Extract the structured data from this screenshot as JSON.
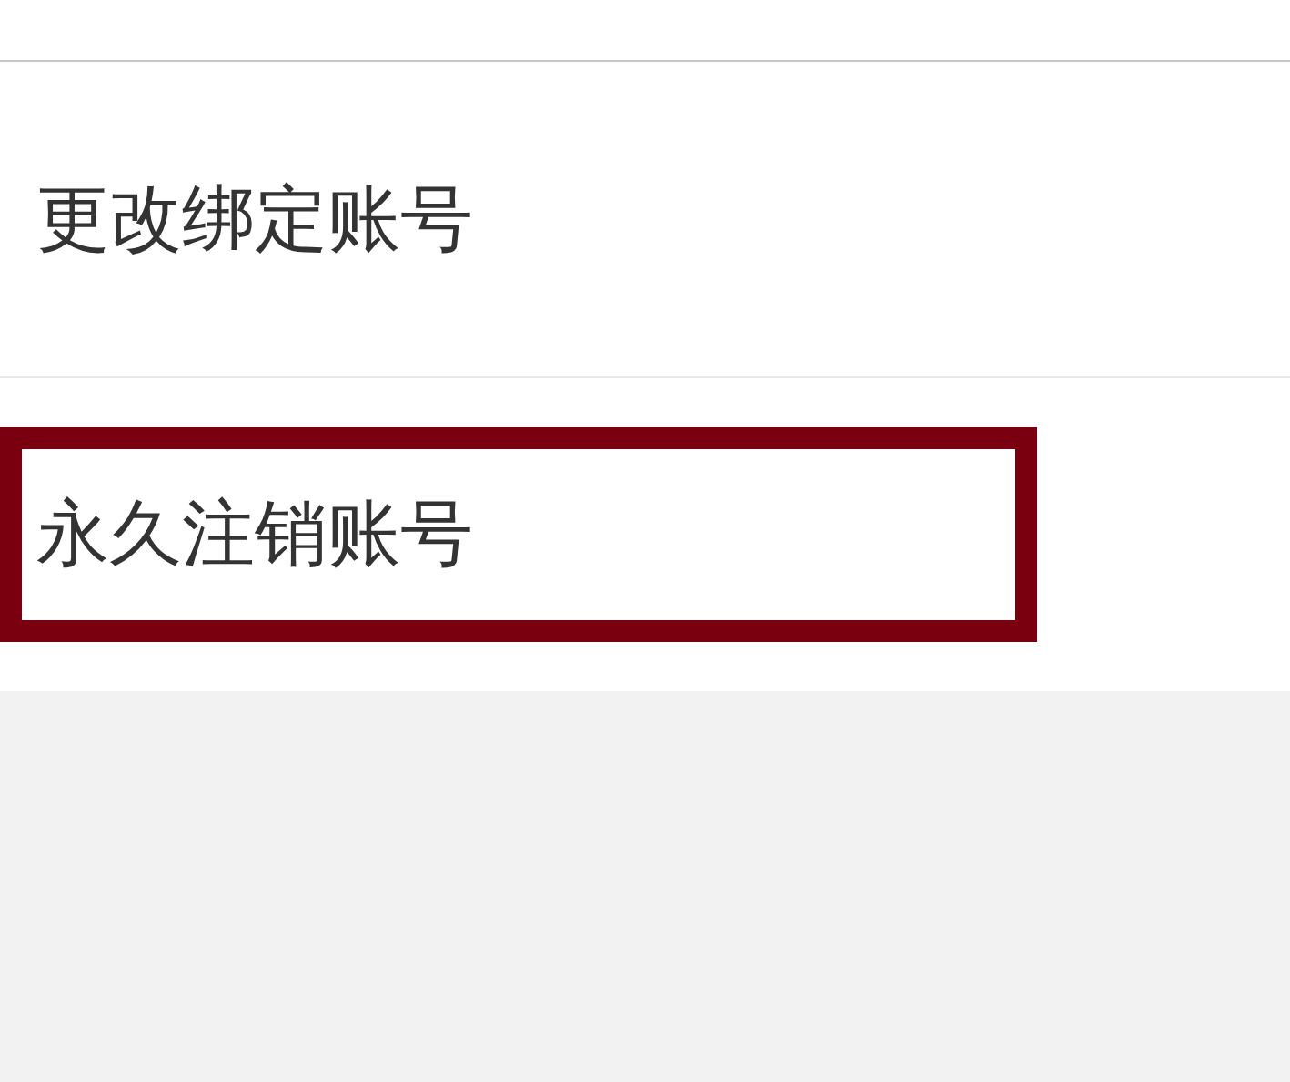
{
  "settings_items": [
    {
      "label": "更改绑定账号",
      "highlighted": false
    },
    {
      "label": "永久注销账号",
      "highlighted": true
    }
  ]
}
